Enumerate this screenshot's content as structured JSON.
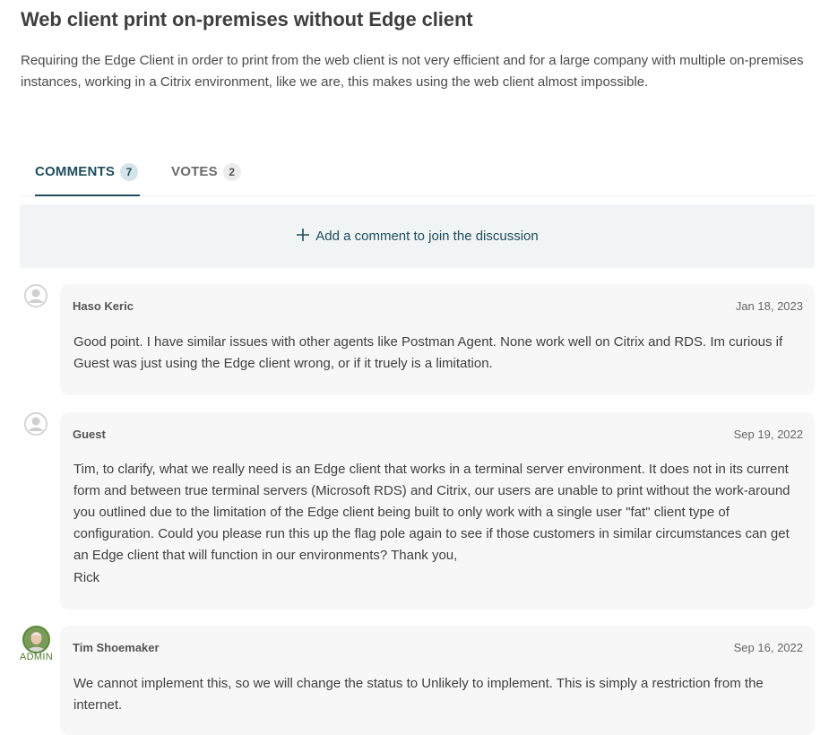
{
  "idea": {
    "title": "Web client print on-premises without Edge client",
    "description": "Requiring the Edge Client in order to print from the web client is not very efficient and for a large company with multiple on-premises instances, working in a Citrix environment, like we are, this makes using the web client almost impossible."
  },
  "tabs": [
    {
      "label": "COMMENTS",
      "count": "7",
      "active": true
    },
    {
      "label": "VOTES",
      "count": "2",
      "active": false
    }
  ],
  "add_comment": {
    "icon": "plus-icon",
    "label": "Add a comment to join the discussion"
  },
  "comments": [
    {
      "author": "Haso Keric",
      "date": "Jan 18, 2023",
      "avatar": "user-silhouette-icon",
      "text": "Good point. I have similar issues with other agents like Postman Agent. None work well on Citrix and RDS. Im curious if Guest was just using the Edge client wrong, or if it truely is a limitation."
    },
    {
      "author": "Guest",
      "date": "Sep 19, 2022",
      "avatar": "user-silhouette-icon",
      "text": "Tim, to clarify, what we really need is an Edge client that works in a terminal server environment. It does not in its current form and between true terminal servers (Microsoft RDS) and Citrix, our users are unable to print without the work-around you outlined due to the limitation of the Edge client being built to only work with a single user \"fat\" client type of configuration. Could you please run this up the flag pole again to see if those customers in similar circumstances can get an Edge client that will function in our environments? Thank you,",
      "signature": "Rick"
    },
    {
      "author": "Tim Shoemaker",
      "date": "Sep 16, 2022",
      "avatar": "user-photo",
      "role": "ADMIN",
      "text": "We cannot implement this, so we will change the status to Unlikely to implement. This is simply a restriction from the internet."
    }
  ],
  "colors": {
    "accent": "#1e4d5c",
    "admin": "#4f7b2f",
    "bubble": "#f7f7f7",
    "banner": "#f1f4f5"
  }
}
